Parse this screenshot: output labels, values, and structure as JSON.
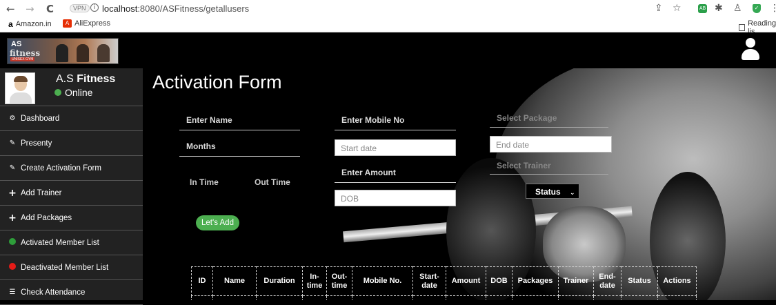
{
  "browser": {
    "back": "←",
    "forward": "→",
    "reload": "C",
    "vpn": "VPN",
    "url_host": "localhost",
    "url_path": ":8080/ASFitness/getallusers",
    "bookmarks": [
      {
        "icon": "amazon-icon",
        "glyph": "a",
        "label": "Amazon.in"
      },
      {
        "icon": "aliexpress-icon",
        "glyph": "A",
        "label": "AliExpress"
      }
    ],
    "reading_list": "Reading lis"
  },
  "app": {
    "logo_as": "AS",
    "logo_fitness": "fitness",
    "logo_sub": "UNISEX GYM",
    "brand_prefix": "A.S ",
    "brand_bold": "Fitness",
    "status_text": "Online",
    "online_color": "#4caf50"
  },
  "sidebar": {
    "items": [
      {
        "label": "Dashboard",
        "icon": "dashboard-icon",
        "glyph": "⚙"
      },
      {
        "label": "Presenty",
        "icon": "pencil-icon",
        "glyph": "✎"
      },
      {
        "label": "Create Activation Form",
        "icon": "pencil-icon",
        "glyph": "✎"
      },
      {
        "label": "Add Trainer",
        "icon": "plus-icon",
        "glyph": "+"
      },
      {
        "label": "Add Packages",
        "icon": "plus-icon",
        "glyph": "+"
      },
      {
        "label": "Activated Member List",
        "icon": "green-dot-icon",
        "color": "#2e9e3a"
      },
      {
        "label": "Deactivated Member List",
        "icon": "red-dot-icon",
        "color": "#e41b17"
      },
      {
        "label": "Check Attendance",
        "icon": "list-icon",
        "glyph": "☰"
      }
    ]
  },
  "form": {
    "title": "Activation Form",
    "name_placeholder": "Enter Name",
    "mobile_placeholder": "Enter Mobile No",
    "package_placeholder": "Select Package",
    "months_placeholder": "Months",
    "start_date_placeholder": "Start date",
    "end_date_placeholder": "End date",
    "in_time_label": "In Time",
    "out_time_label": "Out Time",
    "amount_placeholder": "Enter Amount",
    "trainer_placeholder": "Select Trainer",
    "dob_placeholder": "DOB",
    "status_value": "Status",
    "add_button": "Let's Add",
    "add_button_color": "#4caf50"
  },
  "table": {
    "headers": [
      "ID",
      "Name",
      "Duration",
      "In-\ntime",
      "Out-\ntime",
      "Mobile No.",
      "Start-\ndate",
      "Amount",
      "DOB",
      "Packages",
      "Trainer",
      "End-\ndate",
      "Status",
      "Actions"
    ]
  }
}
